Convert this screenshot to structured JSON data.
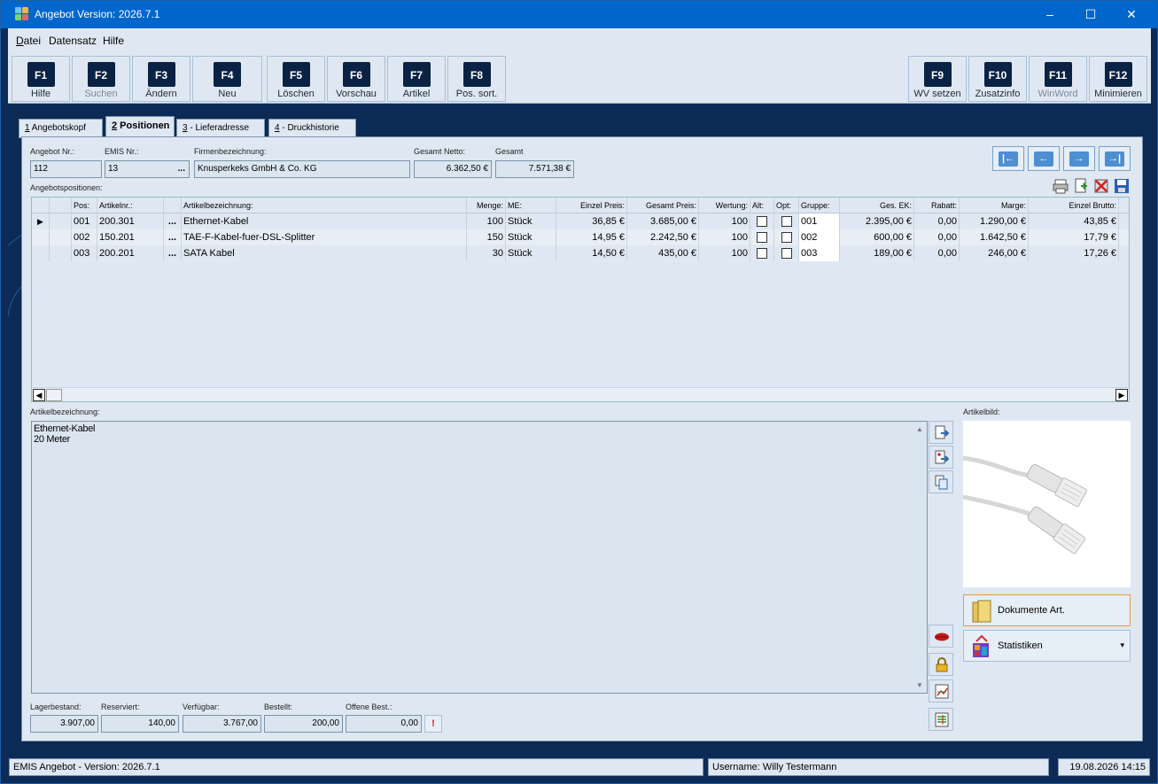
{
  "window": {
    "title": "Angebot Version: 2026.7.1"
  },
  "menu": [
    {
      "label": "Datei",
      "u": "D",
      "rest": "atei"
    },
    {
      "label": "Datensatz"
    },
    {
      "label": "Hilfe"
    }
  ],
  "toolbar": [
    {
      "key": "F1",
      "label": "Hilfe",
      "enabled": true
    },
    {
      "key": "F2",
      "label": "Suchen",
      "enabled": false
    },
    {
      "key": "F3",
      "label": "Ändern",
      "enabled": true
    },
    {
      "key": "F4",
      "label": "Neu",
      "enabled": true
    },
    {
      "key": "F5",
      "label": "Löschen",
      "enabled": true
    },
    {
      "key": "F6",
      "label": "Vorschau",
      "enabled": true
    },
    {
      "key": "F7",
      "label": "Artikel",
      "enabled": true
    },
    {
      "key": "F8",
      "label": "Pos. sort.",
      "enabled": true
    },
    {
      "key": "F9",
      "label": "WV setzen",
      "enabled": true
    },
    {
      "key": "F10",
      "label": "Zusatzinfo",
      "enabled": true
    },
    {
      "key": "F11",
      "label": "WinWord",
      "enabled": false
    },
    {
      "key": "F12",
      "label": "Minimieren",
      "enabled": true
    }
  ],
  "tabs": [
    {
      "num": "1",
      "label": " Angebotskopf"
    },
    {
      "num": "2",
      "label": " Positionen"
    },
    {
      "num": "3",
      "label": " - Lieferadresse"
    },
    {
      "num": "4",
      "label": " - Druckhistorie"
    }
  ],
  "header": {
    "angebot_nr_label": "Angebot Nr.:",
    "angebot_nr": "112",
    "emis_nr_label": "EMIS Nr.:",
    "emis_nr": "13",
    "emis_btn": "...",
    "firma_label": "Firmenbezeichnung:",
    "firma": "Knusperkeks GmbH & Co. KG",
    "netto_label": "Gesamt Netto:",
    "netto": "6.362,50 €",
    "gesamt_label": "Gesamt",
    "gesamt": "7.571,38 €"
  },
  "positions": {
    "label": "Angebotspositionen:",
    "columns": [
      "Pos:",
      "Artikelnr.:",
      "Artikelbezeichnung:",
      "Menge:",
      "ME:",
      "Einzel Preis:",
      "Gesamt Preis:",
      "Wertung:",
      "Alt:",
      "Opt:",
      "Gruppe:",
      "Ges. EK:",
      "Rabatt:",
      "Marge:",
      "Einzel Brutto:"
    ],
    "rows": [
      {
        "pos": "001",
        "artnr": "200.301",
        "dots": "...",
        "bez": "Ethernet-Kabel",
        "menge": "100",
        "me": "Stück",
        "ep": "36,85 €",
        "gp": "3.685,00 €",
        "wertung": "100",
        "gruppe": "001",
        "gesek": "2.395,00 €",
        "rabatt": "0,00",
        "marge": "1.290,00 €",
        "brutto": "43,85 €"
      },
      {
        "pos": "002",
        "artnr": "150.201",
        "dots": "...",
        "bez": "TAE-F-Kabel-fuer-DSL-Splitter",
        "menge": "150",
        "me": "Stück",
        "ep": "14,95 €",
        "gp": "2.242,50 €",
        "wertung": "100",
        "gruppe": "002",
        "gesek": "600,00 €",
        "rabatt": "0,00",
        "marge": "1.642,50 €",
        "brutto": "17,79 €"
      },
      {
        "pos": "003",
        "artnr": "200.201",
        "dots": "...",
        "bez": "SATA Kabel",
        "menge": "30",
        "me": "Stück",
        "ep": "14,50 €",
        "gp": "435,00 €",
        "wertung": "100",
        "gruppe": "003",
        "gesek": "189,00 €",
        "rabatt": "0,00",
        "marge": "246,00 €",
        "brutto": "17,26 €"
      }
    ]
  },
  "detail": {
    "desc_label": "Artikelbezeichnung:",
    "desc_lines": [
      "Ethernet-Kabel",
      "20 Meter"
    ],
    "bild_label": "Artikelbild:",
    "dokumente": "Dokumente Art.",
    "statistiken": "Statistiken"
  },
  "stock": {
    "lager_label": "Lagerbestand:",
    "lager": "3.907,00",
    "reserviert_label": "Reserviert:",
    "reserviert": "140,00",
    "verfuegbar_label": "Verfügbar:",
    "verfuegbar": "3.767,00",
    "bestellt_label": "Bestellt:",
    "bestellt": "200,00",
    "offene_label": "Offene Best.:",
    "offene": "0,00"
  },
  "status": {
    "app": "EMIS Angebot - Version: 2026.7.1",
    "user": "Username: Willy Testermann",
    "datetime": "19.08.2026 14:15"
  }
}
